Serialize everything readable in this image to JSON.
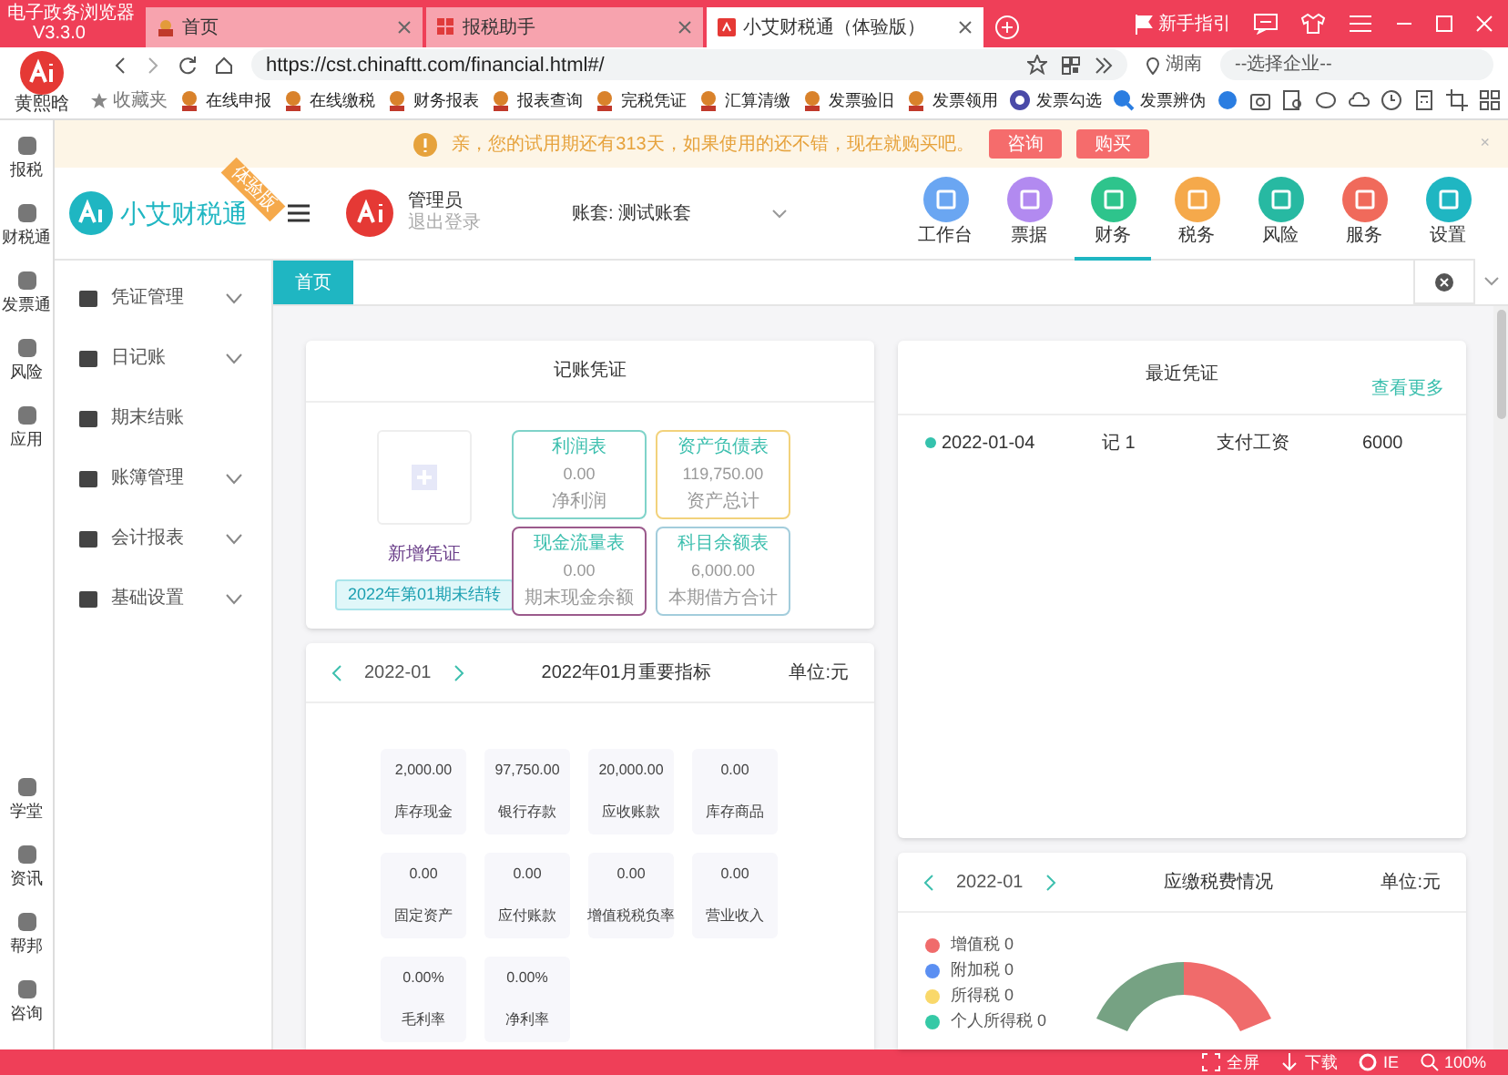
{
  "browser": {
    "app_name": "电子政务浏览器",
    "version": "V3.3.0",
    "tabs": [
      {
        "label": "首页",
        "selected": false
      },
      {
        "label": "报税助手",
        "selected": false
      },
      {
        "label": "小艾财税通（体验版）",
        "selected": true
      }
    ],
    "guide": "新手指引",
    "user_name": "黄熙晗",
    "url": "https://cst.chinaftt.com/financial.html#/",
    "region": "湖南",
    "company_placeholder": "--选择企业--",
    "bookmarks_label": "收藏夹",
    "bookmarks": [
      "在线申报",
      "在线缴税",
      "财务报表",
      "报表查询",
      "完税凭证",
      "汇算清缴",
      "发票验旧",
      "发票领用",
      "发票勾选",
      "发票辨伪"
    ]
  },
  "rail": {
    "top": [
      "报税",
      "财税通",
      "发票通",
      "风险",
      "应用"
    ],
    "bottom": [
      "学堂",
      "资讯",
      "帮邦",
      "咨询"
    ]
  },
  "notice": {
    "text": "亲，您的试用期还有313天，如果使用的还不错，现在就购买吧。",
    "buttons": [
      "咨询",
      "购买"
    ],
    "close": "×"
  },
  "header": {
    "logo": "小艾财税通",
    "ribbon": "体验版",
    "user": "管理员",
    "logout": "退出登录",
    "ledger_label": "账套:",
    "ledger": "测试账套",
    "nav": [
      {
        "label": "工作台",
        "color": "#6aa6f2",
        "selected": false
      },
      {
        "label": "票据",
        "color": "#b28af0",
        "selected": false
      },
      {
        "label": "财务",
        "color": "#2ec48c",
        "selected": true
      },
      {
        "label": "税务",
        "color": "#f5a94b",
        "selected": false
      },
      {
        "label": "风险",
        "color": "#27b9a2",
        "selected": false
      },
      {
        "label": "服务",
        "color": "#f06a5b",
        "selected": false
      },
      {
        "label": "设置",
        "color": "#1fb6c2",
        "selected": false
      }
    ]
  },
  "sidebar": {
    "items": [
      {
        "label": "凭证管理",
        "kind": "group"
      },
      {
        "label": "日记账",
        "kind": "group"
      },
      {
        "label": "期末结账",
        "kind": "link"
      },
      {
        "label": "账簿管理",
        "kind": "group"
      },
      {
        "label": "会计报表",
        "kind": "group"
      },
      {
        "label": "基础设置",
        "kind": "group"
      }
    ]
  },
  "page_tabs": [
    {
      "label": "首页",
      "selected": true
    }
  ],
  "voucher_card": {
    "title": "记账凭证",
    "add_label": "新增凭证",
    "period_button": "2022年第01期未结转",
    "reports": [
      {
        "title": "利润表",
        "value": "0.00",
        "caption": "净利润",
        "color": "#7fd3c9"
      },
      {
        "title": "资产负债表",
        "value": "119,750.00",
        "caption": "资产总计",
        "color": "#f2d27c"
      },
      {
        "title": "现金流量表",
        "value": "0.00",
        "caption": "期末现金余额",
        "color": "#9b5a8c"
      },
      {
        "title": "科目余额表",
        "value": "6,000.00",
        "caption": "本期借方合计",
        "color": "#a3cddc"
      }
    ]
  },
  "recent_card": {
    "title": "最近凭证",
    "more": "查看更多",
    "rows": [
      {
        "date": "2022-01-04",
        "number": "记 1",
        "summary": "支付工资",
        "amount": "6000"
      }
    ]
  },
  "indicators_card": {
    "period": "2022-01",
    "title": "2022年01月重要指标",
    "unit": "单位:元",
    "items": [
      {
        "value": "2,000.00",
        "label": "库存现金"
      },
      {
        "value": "97,750.00",
        "label": "银行存款"
      },
      {
        "value": "20,000.00",
        "label": "应收账款"
      },
      {
        "value": "0.00",
        "label": "库存商品"
      },
      {
        "value": "0.00",
        "label": "固定资产"
      },
      {
        "value": "0.00",
        "label": "应付账款"
      },
      {
        "value": "0.00",
        "label": "增值税税负率"
      },
      {
        "value": "0.00",
        "label": "营业收入"
      },
      {
        "value": "0.00%",
        "label": "毛利率"
      },
      {
        "value": "0.00%",
        "label": "净利率"
      }
    ]
  },
  "tax_card": {
    "period": "2022-01",
    "title": "应缴税费情况",
    "unit": "单位:元",
    "legend": [
      {
        "label": "增值税",
        "value": "0",
        "color": "#f06b6b"
      },
      {
        "label": "附加税",
        "value": "0",
        "color": "#5b8ff2"
      },
      {
        "label": "所得税",
        "value": "0",
        "color": "#f9d86a"
      },
      {
        "label": "个人所得税",
        "value": "0",
        "color": "#35c9a6"
      }
    ]
  },
  "status_bar": [
    "全屏",
    "下载",
    "IE",
    "100%"
  ]
}
